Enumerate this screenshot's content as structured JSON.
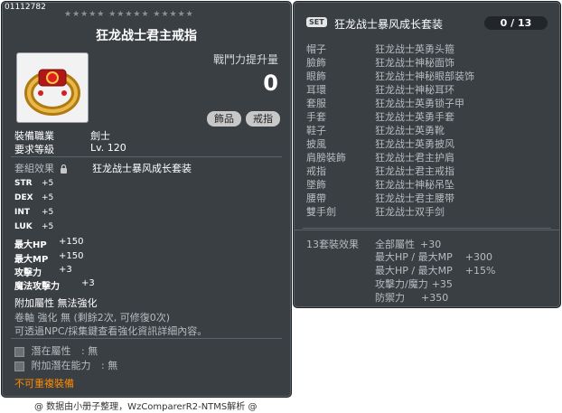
{
  "item": {
    "id": "01112782",
    "stars": "★★★★★ ★★★★★ ★★★★★",
    "name": "狂龙战士君主戒指",
    "icon": "ring-icon",
    "power_label": "戰鬥力提升量",
    "power_value": "0",
    "tags": [
      "飾品",
      "戒指"
    ],
    "job_label": "裝備職業",
    "job_value": "劍士",
    "level_label": "要求等級",
    "level_value": "Lv. 120",
    "set_label": "套組效果",
    "set_lock_icon": "lock-icon",
    "set_value": "狂龙战士暴风成长套装",
    "stats": [
      {
        "name": "STR",
        "value": "+5"
      },
      {
        "name": "DEX",
        "value": "+5"
      },
      {
        "name": "INT",
        "value": "+5"
      },
      {
        "name": "LUK",
        "value": "+5"
      }
    ],
    "stats2": [
      {
        "name": "最大HP",
        "value": "+150"
      },
      {
        "name": "最大MP",
        "value": "+150"
      },
      {
        "name": "攻擊力",
        "value": "+3"
      },
      {
        "name": "魔法攻擊力",
        "value": "+3"
      }
    ],
    "additional": "附加屬性 無法強化",
    "scroll_text": "卷軸 強化 無 (剩餘2次, 可修復0次)",
    "npc_text": "可透過NPC/採集鍵查看強化資訊詳細內容。",
    "potential_label": "潛在屬性",
    "potential_value": ": 無",
    "add_potential_label": "附加潛在能力",
    "add_potential_value": ": 無",
    "unique_text": "不可重複裝備"
  },
  "set": {
    "badge": "SET",
    "title": "狂龙战士暴风成长套装",
    "count": "0 / 13",
    "pieces": [
      {
        "slot": "帽子",
        "name": "狂龙战士英勇头箍"
      },
      {
        "slot": "臉飾",
        "name": "狂龙战士神秘面饰"
      },
      {
        "slot": "眼飾",
        "name": "狂龙战士神秘眼部装饰"
      },
      {
        "slot": "耳環",
        "name": "狂龙战士神秘耳环"
      },
      {
        "slot": "套服",
        "name": "狂龙战士英勇锁子甲"
      },
      {
        "slot": "手套",
        "name": "狂龙战士英勇手套"
      },
      {
        "slot": "鞋子",
        "name": "狂龙战士英勇靴"
      },
      {
        "slot": "披風",
        "name": "狂龙战士英勇披风"
      },
      {
        "slot": "肩膀裝飾",
        "name": "狂龙战士君主护肩"
      },
      {
        "slot": "戒指",
        "name": "狂龙战士君主戒指"
      },
      {
        "slot": "墜飾",
        "name": "狂龙战士神秘吊坠"
      },
      {
        "slot": "腰帶",
        "name": "狂龙战士君主腰带"
      },
      {
        "slot": "雙手劍",
        "name": "狂龙战士双手剑"
      }
    ],
    "effect_label": "13套裝效果",
    "effects": [
      {
        "name": "全部屬性",
        "value": "+30"
      },
      {
        "name": "最大HP / 最大MP",
        "value": "+300"
      },
      {
        "name": "最大HP / 最大MP",
        "value": "+15%"
      },
      {
        "name": "攻擊力/魔力",
        "value": "+35"
      },
      {
        "name": "防禦力",
        "value": "+350"
      }
    ]
  },
  "footer": "@ 数据由小册子整理，WzComparerR2-NTMS解析 @"
}
